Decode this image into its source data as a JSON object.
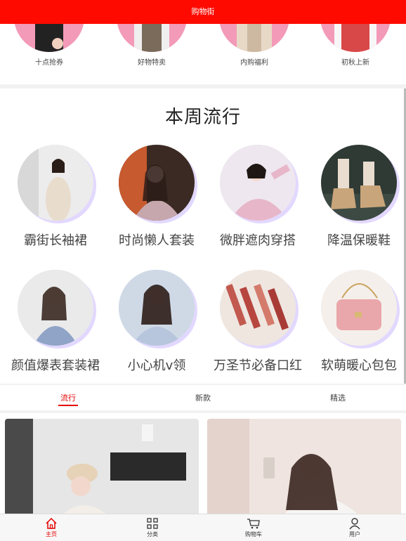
{
  "header": {
    "title": "购物街"
  },
  "top_categories": [
    {
      "label": "十点抢券"
    },
    {
      "label": "好物特卖"
    },
    {
      "label": "内购福利"
    },
    {
      "label": "初秋上新"
    }
  ],
  "weekly": {
    "title": "本周流行",
    "items": [
      {
        "label": "霸街长袖裙"
      },
      {
        "label": "时尚懒人套装"
      },
      {
        "label": "微胖遮肉穿搭"
      },
      {
        "label": "降温保暖鞋"
      },
      {
        "label": "颜值爆表套装裙"
      },
      {
        "label": "小心机v领"
      },
      {
        "label": "万圣节必备口红"
      },
      {
        "label": "软萌暖心包包"
      }
    ]
  },
  "tabs": [
    {
      "label": "流行",
      "active": true
    },
    {
      "label": "新款",
      "active": false
    },
    {
      "label": "精选",
      "active": false
    }
  ],
  "bottom_nav": [
    {
      "label": "主页",
      "icon": "home-icon",
      "active": true
    },
    {
      "label": "分类",
      "icon": "grid-icon",
      "active": false
    },
    {
      "label": "购物车",
      "icon": "cart-icon",
      "active": false
    },
    {
      "label": "用户",
      "icon": "user-icon",
      "active": false
    }
  ],
  "colors": {
    "accent": "#ff0a00",
    "active": "#e60000",
    "circle_shadow": "#e2d8ff"
  }
}
